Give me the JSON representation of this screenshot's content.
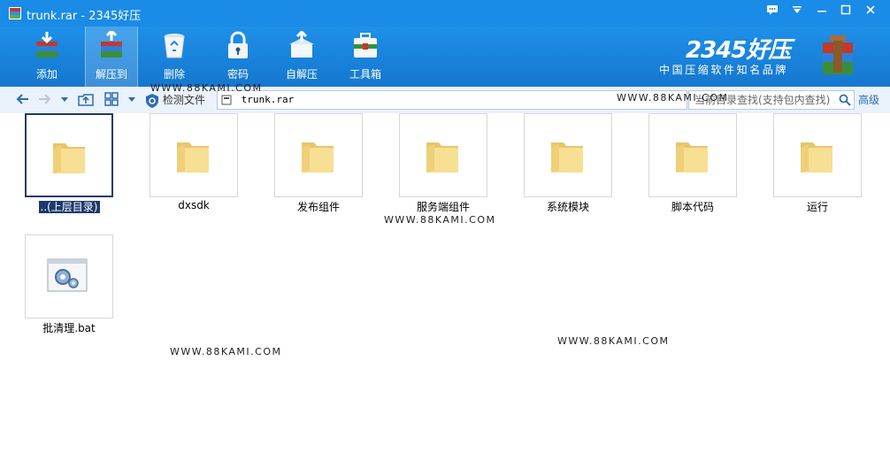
{
  "window": {
    "title": "trunk.rar - 2345好压",
    "buttons": [
      "msg-icon",
      "menu-icon",
      "minimize-icon",
      "maximize-icon",
      "close-icon"
    ]
  },
  "toolbar": {
    "items": [
      {
        "label": "添加",
        "icon": "add-icon"
      },
      {
        "label": "解压到",
        "icon": "extract-icon"
      },
      {
        "label": "删除",
        "icon": "delete-icon"
      },
      {
        "label": "密码",
        "icon": "lock-icon"
      },
      {
        "label": "自解压",
        "icon": "selfextract-icon"
      },
      {
        "label": "工具箱",
        "icon": "toolbox-icon"
      }
    ]
  },
  "brand": {
    "logo": "2345好压",
    "slogan": "中国压缩软件知名品牌"
  },
  "address_bar": {
    "detect_label": "检测文件",
    "path": "trunk.rar",
    "search_placeholder": "当前目录查找(支持包内查找)",
    "advanced": "高级"
  },
  "files": [
    {
      "name": "..(上层目录)",
      "type": "folder",
      "selected": true
    },
    {
      "name": "dxsdk",
      "type": "folder"
    },
    {
      "name": "发布组件",
      "type": "folder"
    },
    {
      "name": "服务端组件",
      "type": "folder"
    },
    {
      "name": "系统模块",
      "type": "folder"
    },
    {
      "name": "脚本代码",
      "type": "folder"
    },
    {
      "name": "运行",
      "type": "folder"
    },
    {
      "name": "批清理.bat",
      "type": "bat"
    }
  ],
  "watermarks": [
    "WWW.88KAMI.COM",
    "WWW.88KAMI.COM",
    "WWW.88KAMI.COM",
    "WWW.88KAMI.COM",
    "WWW.88KAMI.COM"
  ],
  "colors": {
    "accent": "#1a8be6",
    "selection": "#1e3a6e"
  }
}
